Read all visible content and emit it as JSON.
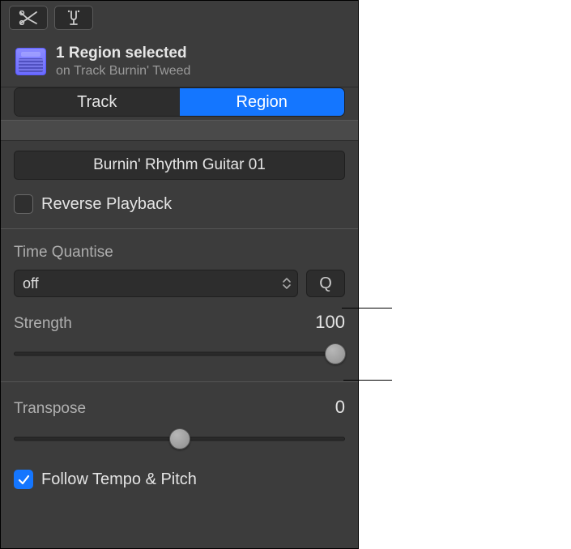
{
  "header": {
    "title": "1 Region selected",
    "subtitle": "on Track Burnin' Tweed"
  },
  "tabs": {
    "track": "Track",
    "region": "Region"
  },
  "region_name": "Burnin' Rhythm Guitar 01",
  "reverse": {
    "label": "Reverse Playback",
    "checked": false
  },
  "quantise": {
    "label": "Time Quantise",
    "value": "off",
    "q_button": "Q"
  },
  "strength": {
    "label": "Strength",
    "value": "100",
    "slider_percent": 97
  },
  "transpose": {
    "label": "Transpose",
    "value": "0",
    "slider_percent": 50
  },
  "follow": {
    "label": "Follow Tempo & Pitch",
    "checked": true
  }
}
